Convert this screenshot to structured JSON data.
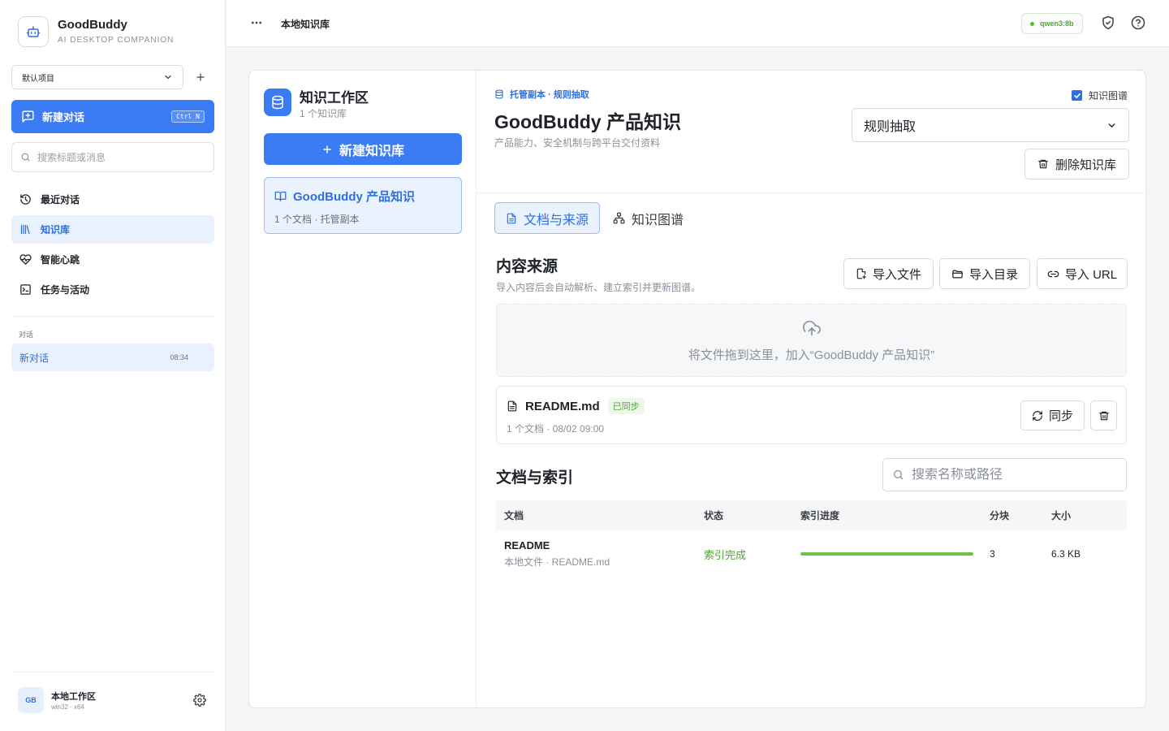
{
  "brand": {
    "name": "GoodBuddy",
    "subtitle": "AI DESKTOP COMPANION"
  },
  "project": {
    "selected": "默认项目"
  },
  "new_chat": {
    "label": "新建对话",
    "shortcut": "Ctrl N"
  },
  "side_search": {
    "placeholder": "搜索标题或消息"
  },
  "nav": {
    "items": [
      {
        "label": "最近对话"
      },
      {
        "label": "知识库"
      },
      {
        "label": "智能心跳"
      },
      {
        "label": "任务与活动"
      }
    ]
  },
  "conversations": {
    "section_label": "对话",
    "items": [
      {
        "title": "新对话",
        "time": "08:34"
      }
    ]
  },
  "user": {
    "avatar": "GB",
    "name": "本地工作区",
    "platform": "win32 · x64"
  },
  "topbar": {
    "title": "本地知识库",
    "model": "qwen3:8b"
  },
  "workspace": {
    "title": "知识工作区",
    "subtitle": "1 个知识库",
    "new_button": "新建知识库",
    "items": [
      {
        "name": "GoodBuddy 产品知识",
        "meta": "1 个文档 · 托管副本"
      }
    ]
  },
  "detail": {
    "tag": "托管副本 · 规则抽取",
    "name": "GoodBuddy 产品知识",
    "description": "产品能力、安全机制与跨平台交付资料",
    "graph_toggle": {
      "label": "知识图谱",
      "checked": true
    },
    "strategy": "规则抽取",
    "delete_button": "删除知识库",
    "tabs": [
      {
        "label": "文档与来源"
      },
      {
        "label": "知识图谱"
      }
    ]
  },
  "sources": {
    "title": "内容来源",
    "description": "导入内容后会自动解析、建立索引并更新图谱。",
    "buttons": {
      "import_file": "导入文件",
      "import_dir": "导入目录",
      "import_url": "导入 URL"
    },
    "dropzone_text": "将文件拖到这里，加入“GoodBuddy 产品知识”",
    "items": [
      {
        "name": "README.md",
        "badge": "已同步",
        "meta": "1 个文档 · 08/02 09:00",
        "sync_label": "同步"
      }
    ]
  },
  "documents": {
    "title": "文档与索引",
    "search_placeholder": "搜索名称或路径",
    "columns": [
      "文档",
      "状态",
      "索引进度",
      "分块",
      "大小"
    ],
    "rows": [
      {
        "title": "README",
        "source": "本地文件 · README.md",
        "status": "索引完成",
        "progress": 1.0,
        "chunks": "3",
        "size": "6.3 KB"
      }
    ]
  },
  "colors": {
    "accent": "#3b7cf4",
    "success": "#52a43a",
    "active_bg": "#eaf2fd"
  }
}
